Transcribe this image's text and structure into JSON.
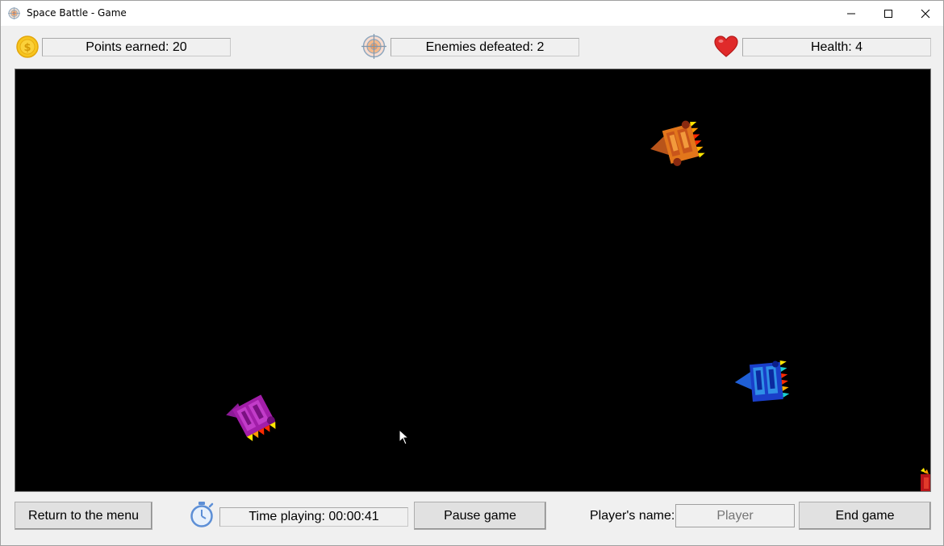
{
  "window": {
    "title": "Space Battle - Game",
    "controls": {
      "minimize": "minimize-icon",
      "maximize": "maximize-icon",
      "close": "close-icon"
    }
  },
  "status": {
    "points_label": "Points earned: 20",
    "enemies_label": "Enemies defeated: 2",
    "health_label": "Health: 4",
    "icons": {
      "points": "coin-icon",
      "enemies": "target-icon",
      "health": "heart-icon"
    }
  },
  "game": {
    "background": "#000000",
    "ships": [
      {
        "name": "enemy-ship-orange",
        "color": "#e2761b"
      },
      {
        "name": "enemy-ship-blue",
        "color": "#1f5fd6"
      },
      {
        "name": "player-ship-purple",
        "color": "#a21ea9"
      }
    ]
  },
  "controls": {
    "return_label": "Return to the menu",
    "time_label": "Time playing: 00:00:41",
    "pause_label": "Pause game",
    "player_name_label": "Player's name:",
    "player_name_placeholder": "Player",
    "end_label": "End game"
  }
}
